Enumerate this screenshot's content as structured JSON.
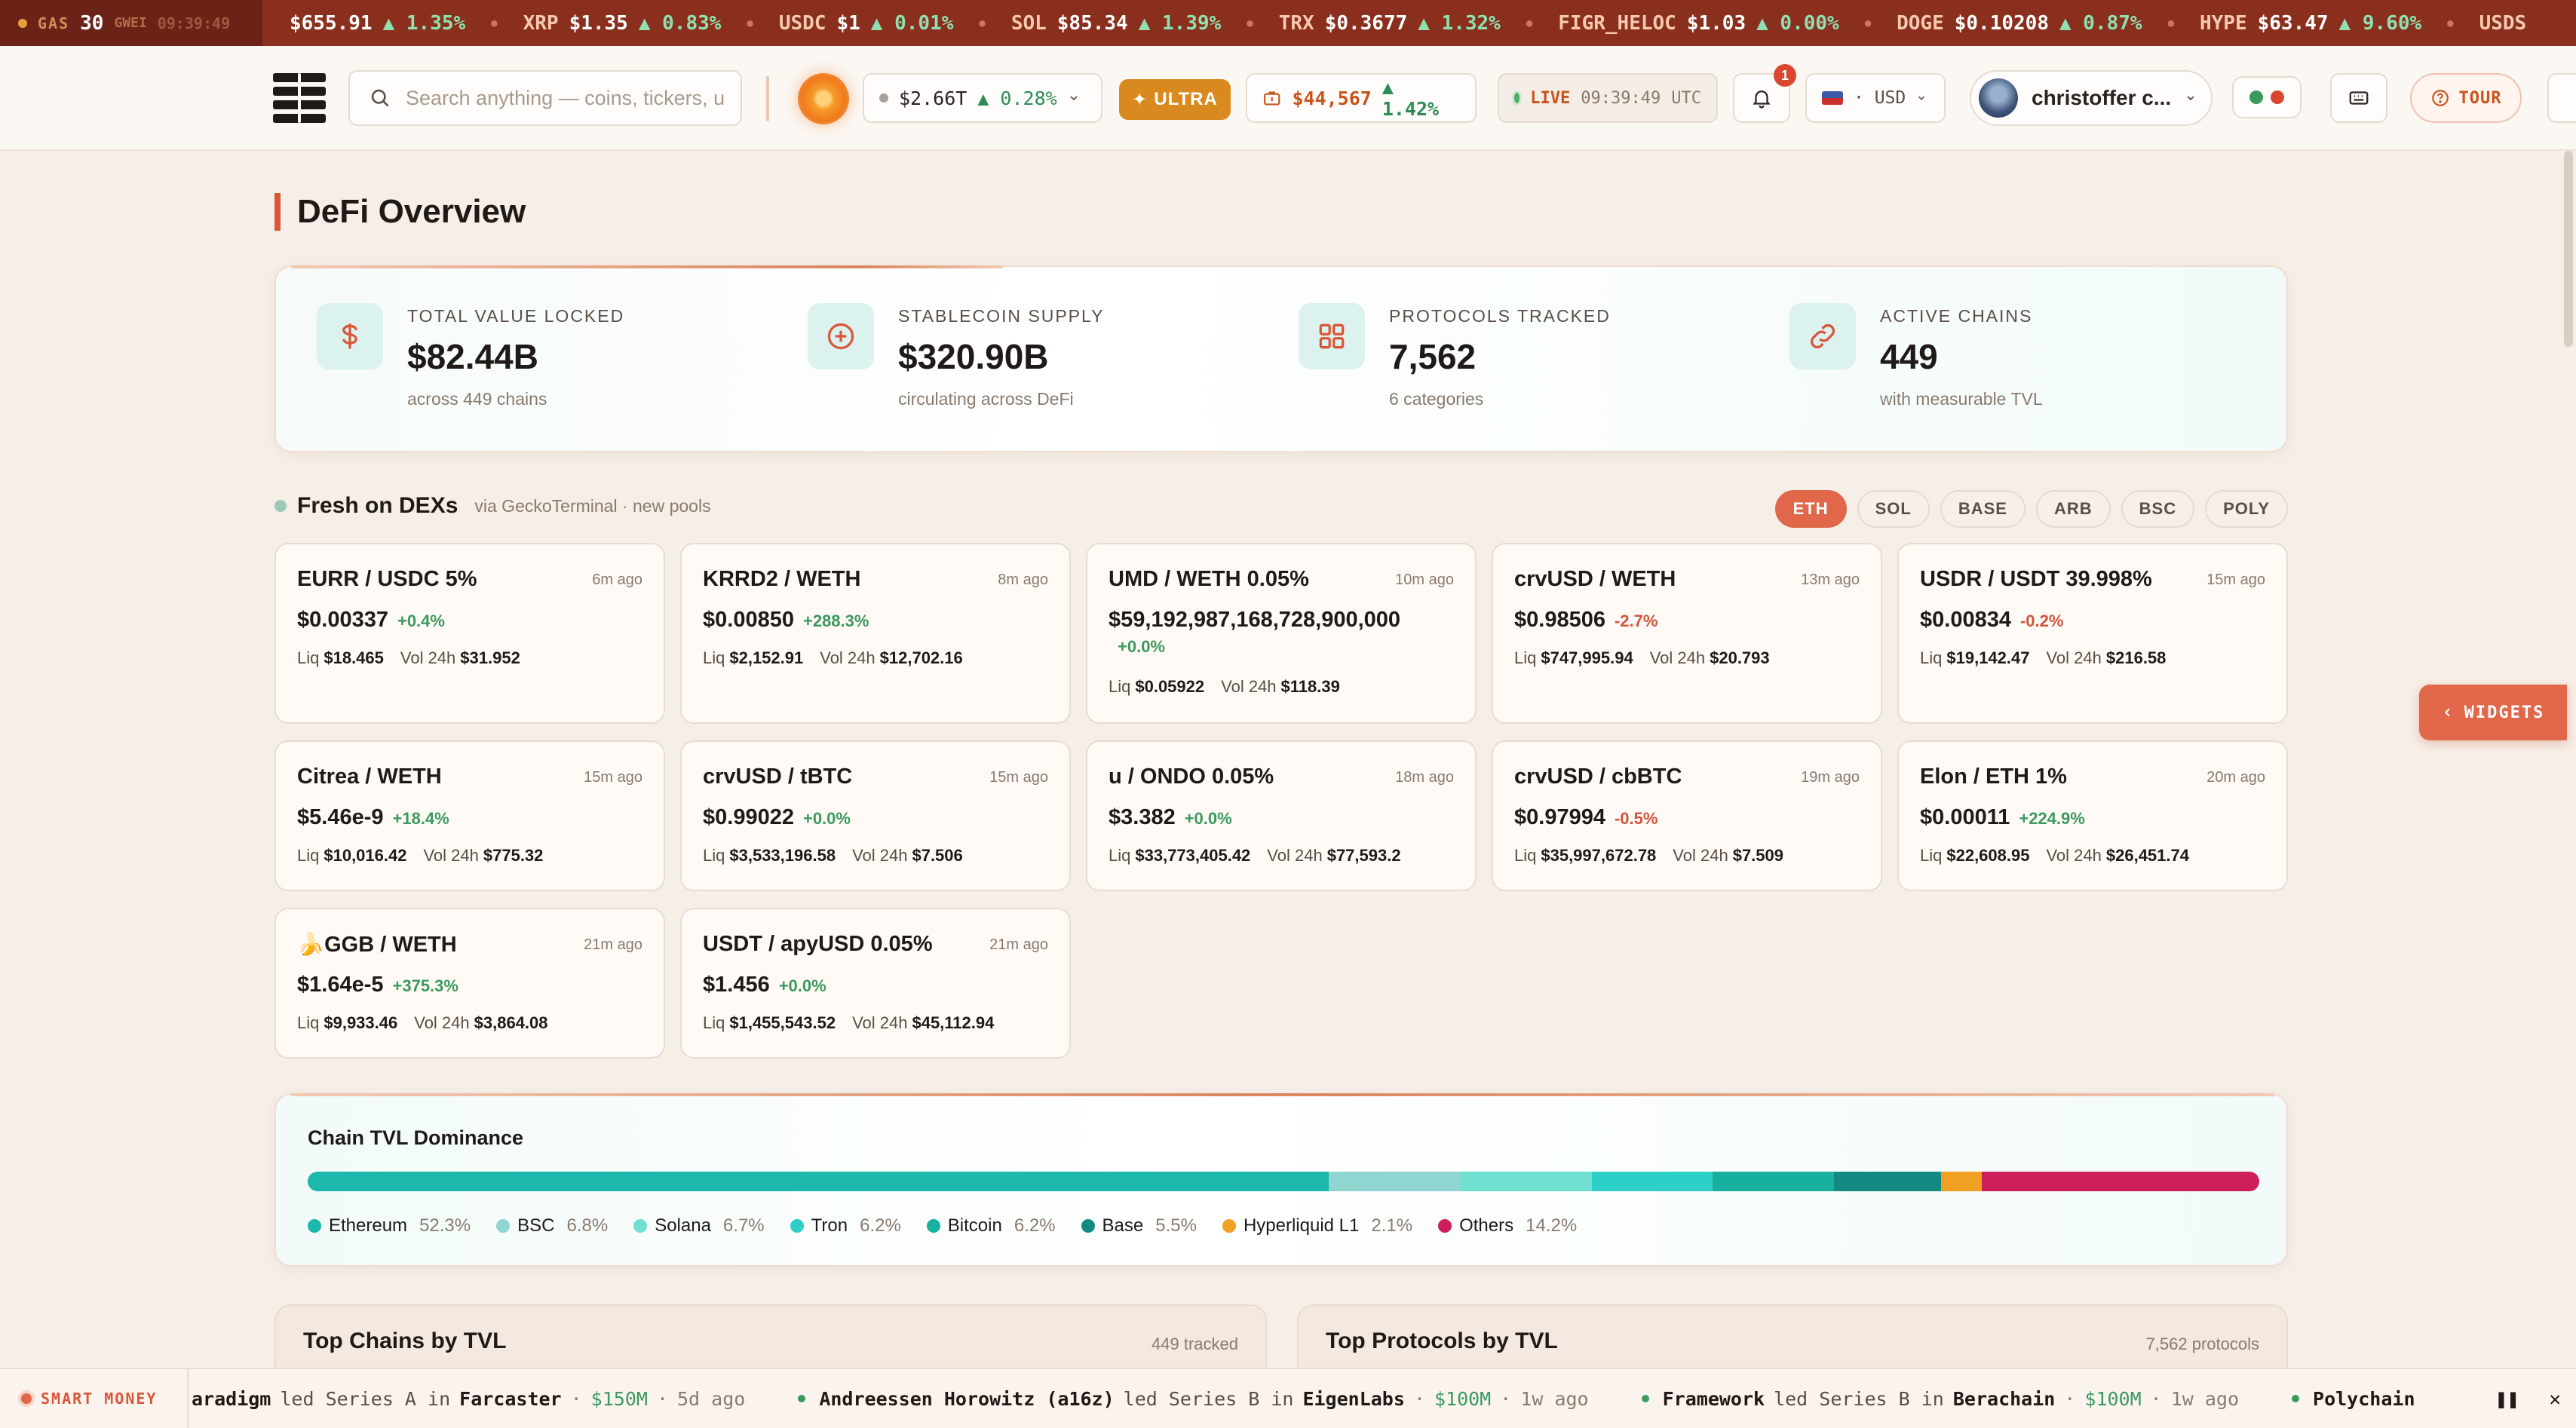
{
  "ticker": {
    "gas": {
      "label": "GAS",
      "value": "30",
      "unit": "GWEI",
      "time": "09:39:49"
    },
    "items": [
      {
        "symbol": "",
        "price": "$655.91",
        "change": "▲ 1.35%"
      },
      {
        "symbol": "XRP",
        "price": "$1.35",
        "change": "▲ 0.83%"
      },
      {
        "symbol": "USDC",
        "price": "$1",
        "change": "▲ 0.01%"
      },
      {
        "symbol": "SOL",
        "price": "$85.34",
        "change": "▲ 1.39%"
      },
      {
        "symbol": "TRX",
        "price": "$0.3677",
        "change": "▲ 1.32%"
      },
      {
        "symbol": "FIGR_HELOC",
        "price": "$1.03",
        "change": "▲ 0.00%"
      },
      {
        "symbol": "DOGE",
        "price": "$0.10208",
        "change": "▲ 0.87%"
      },
      {
        "symbol": "HYPE",
        "price": "$63.47",
        "change": "▲ 9.60%"
      },
      {
        "symbol": "USDS",
        "price": "",
        "change": ""
      }
    ]
  },
  "header": {
    "search_placeholder": "Search anything — coins, tickers, u",
    "market_cap": "$2.66T",
    "market_cap_change": "▲ 0.28%",
    "ultra_label": "ULTRA",
    "portfolio_value": "$44,567",
    "portfolio_change": "▲ 1.42%",
    "live_label": "LIVE",
    "live_time": "09:39:49",
    "live_tz": "UTC",
    "notifications_count": "1",
    "currency": "· USD",
    "user_name": "christoffer c...",
    "tour_label": "TOUR"
  },
  "page": {
    "title": "DeFi Overview"
  },
  "stats": [
    {
      "label": "TOTAL VALUE LOCKED",
      "value": "$82.44B",
      "sub": "across 449 chains",
      "icon": "dollar-icon"
    },
    {
      "label": "STABLECOIN SUPPLY",
      "value": "$320.90B",
      "sub": "circulating across DeFi",
      "icon": "plus-circle-icon"
    },
    {
      "label": "PROTOCOLS TRACKED",
      "value": "7,562",
      "sub": "6 categories",
      "icon": "grid-icon"
    },
    {
      "label": "ACTIVE CHAINS",
      "value": "449",
      "sub": "with measurable TVL",
      "icon": "link-icon"
    }
  ],
  "fresh": {
    "title": "Fresh on DEXs",
    "subtitle": "via GeckoTerminal · new pools",
    "tabs": [
      "ETH",
      "SOL",
      "BASE",
      "ARB",
      "BSC",
      "POLY"
    ],
    "active_tab": "ETH",
    "pools": [
      {
        "name": "EURR / USDC 5%",
        "age": "6m ago",
        "price": "$0.00337",
        "change": "+0.4%",
        "dir": "pos",
        "liq": "$18.465",
        "vol": "$31.952"
      },
      {
        "name": "KRRD2 / WETH",
        "age": "8m ago",
        "price": "$0.00850",
        "change": "+288.3%",
        "dir": "pos",
        "liq": "$2,152.91",
        "vol": "$12,702.16"
      },
      {
        "name": "UMD / WETH 0.05%",
        "age": "10m ago",
        "price": "$59,192,987,168,728,900,000",
        "change": "+0.0%",
        "dir": "zero",
        "liq": "$0.05922",
        "vol": "$118.39"
      },
      {
        "name": "crvUSD / WETH",
        "age": "13m ago",
        "price": "$0.98506",
        "change": "-2.7%",
        "dir": "neg",
        "liq": "$747,995.94",
        "vol": "$20.793"
      },
      {
        "name": "USDR / USDT 39.998%",
        "age": "15m ago",
        "price": "$0.00834",
        "change": "-0.2%",
        "dir": "neg",
        "liq": "$19,142.47",
        "vol": "$216.58"
      },
      {
        "name": "Citrea / WETH",
        "age": "15m ago",
        "price": "$5.46e-9",
        "change": "+18.4%",
        "dir": "pos",
        "liq": "$10,016.42",
        "vol": "$775.32"
      },
      {
        "name": "crvUSD / tBTC",
        "age": "15m ago",
        "price": "$0.99022",
        "change": "+0.0%",
        "dir": "zero",
        "liq": "$3,533,196.58",
        "vol": "$7.506"
      },
      {
        "name": "u / ONDO 0.05%",
        "age": "18m ago",
        "price": "$3.382",
        "change": "+0.0%",
        "dir": "zero",
        "liq": "$33,773,405.42",
        "vol": "$77,593.2"
      },
      {
        "name": "crvUSD / cbBTC",
        "age": "19m ago",
        "price": "$0.97994",
        "change": "-0.5%",
        "dir": "neg",
        "liq": "$35,997,672.78",
        "vol": "$7.509"
      },
      {
        "name": "Elon / ETH 1%",
        "age": "20m ago",
        "price": "$0.00011",
        "change": "+224.9%",
        "dir": "pos",
        "liq": "$22,608.95",
        "vol": "$26,451.74"
      },
      {
        "name": "🍌GGB / WETH",
        "age": "21m ago",
        "price": "$1.64e-5",
        "change": "+375.3%",
        "dir": "pos",
        "liq": "$9,933.46",
        "vol": "$3,864.08"
      },
      {
        "name": "USDT / apyUSD 0.05%",
        "age": "21m ago",
        "price": "$1.456",
        "change": "+0.0%",
        "dir": "zero",
        "liq": "$1,455,543.52",
        "vol": "$45,112.94"
      }
    ],
    "liq_label": "Liq",
    "vol_label": "Vol 24h"
  },
  "dominance": {
    "title": "Chain TVL Dominance",
    "segments": [
      {
        "name": "Ethereum",
        "pct": 52.3,
        "label": "52.3%",
        "color": "#1db8ac"
      },
      {
        "name": "BSC",
        "pct": 6.8,
        "label": "6.8%",
        "color": "#8fd6d0"
      },
      {
        "name": "Solana",
        "pct": 6.7,
        "label": "6.7%",
        "color": "#6fe0cf"
      },
      {
        "name": "Tron",
        "pct": 6.2,
        "label": "6.2%",
        "color": "#2ecfc8"
      },
      {
        "name": "Bitcoin",
        "pct": 6.2,
        "label": "6.2%",
        "color": "#18b09e"
      },
      {
        "name": "Base",
        "pct": 5.5,
        "label": "5.5%",
        "color": "#128a82"
      },
      {
        "name": "Hyperliquid L1",
        "pct": 2.1,
        "label": "2.1%",
        "color": "#f0a022"
      },
      {
        "name": "Others",
        "pct": 14.2,
        "label": "14.2%",
        "color": "#cc1f5c"
      }
    ]
  },
  "bottom_cards": [
    {
      "title": "Top Chains by TVL",
      "meta": "449 tracked"
    },
    {
      "title": "Top Protocols by TVL",
      "meta": "7,562 protocols"
    }
  ],
  "widgets_label": "WIDGETS",
  "smart_money": {
    "label": "SMART MONEY",
    "deals": [
      {
        "investor": "aradigm",
        "round": "led Series A in",
        "target": "Farcaster",
        "amount": "$150M",
        "ago": "5d ago",
        "dot": false
      },
      {
        "investor": "Andreessen Horowitz (a16z)",
        "round": "led Series B in",
        "target": "EigenLabs",
        "amount": "$100M",
        "ago": "1w ago",
        "dot": true
      },
      {
        "investor": "Framework",
        "round": "led Series B in",
        "target": "Berachain",
        "amount": "$100M",
        "ago": "1w ago",
        "dot": true
      },
      {
        "investor": "Polychain",
        "round": "",
        "target": "",
        "amount": "",
        "ago": "",
        "dot": true
      }
    ]
  }
}
